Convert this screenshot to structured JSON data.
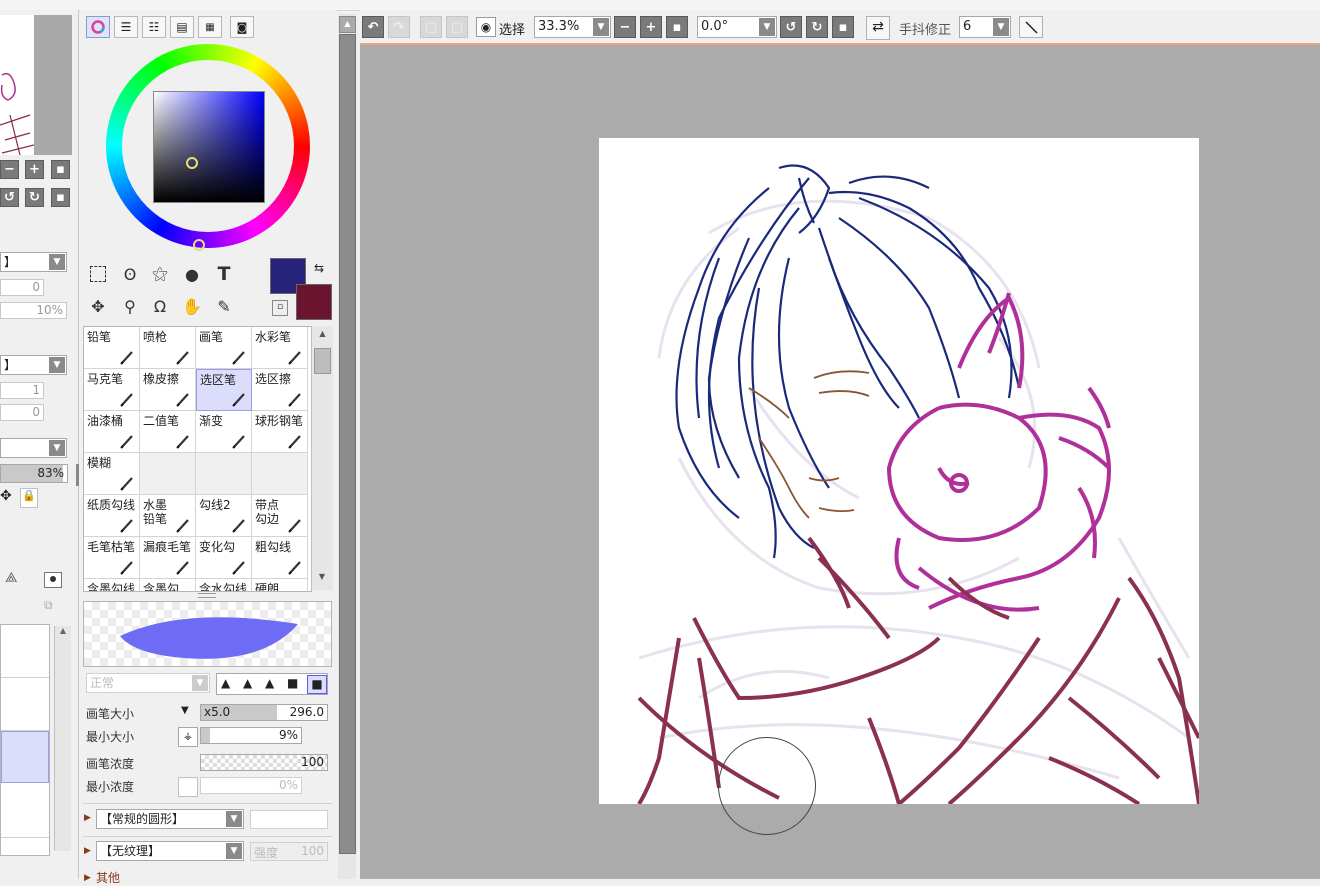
{
  "toolbar": {
    "view_label": "选择",
    "zoom_value": "33.3%",
    "rotation_value": "0.0°",
    "stabilizer_label": "手抖修正",
    "stabilizer_value": "6"
  },
  "left_panel": {
    "field_values": [
      "0",
      "10%",
      "1",
      "0"
    ],
    "combo_1": "】",
    "combo_2": "】",
    "opacity_value": "83%"
  },
  "colors": {
    "primary": "#27227a",
    "secondary": "#6a1430",
    "accent_selection": "#dcdcfb",
    "toolbar_border": "#f4a37a",
    "canvas_bg": "#ababab"
  },
  "brushes": [
    {
      "label": "铅笔",
      "icon": "pencil-icon"
    },
    {
      "label": "喷枪",
      "icon": "airbrush-icon"
    },
    {
      "label": "画笔",
      "icon": "brush-icon"
    },
    {
      "label": "水彩笔",
      "icon": "watercolor-icon"
    },
    {
      "label": "马克笔",
      "icon": "marker-icon"
    },
    {
      "label": "橡皮擦",
      "icon": "eraser-icon"
    },
    {
      "label": "选区笔",
      "icon": "selection-pen-icon",
      "selected": true
    },
    {
      "label": "选区擦",
      "icon": "selection-eraser-icon"
    },
    {
      "label": "油漆桶",
      "icon": "bucket-icon"
    },
    {
      "label": "二值笔",
      "icon": "binary-pen-icon"
    },
    {
      "label": "渐变",
      "icon": "gradient-icon"
    },
    {
      "label": "球形钢笔",
      "icon": "ballpen-icon"
    },
    {
      "label": "模糊",
      "icon": "blur-icon"
    },
    {
      "label": "",
      "icon": ""
    },
    {
      "label": "",
      "icon": ""
    },
    {
      "label": "",
      "icon": ""
    },
    {
      "label": "纸质勾线",
      "icon": "paper-line-icon"
    },
    {
      "label": "水墨\n铅笔",
      "icon": "ink-pencil-icon"
    },
    {
      "label": "勾线2",
      "icon": "line2-icon"
    },
    {
      "label": "带点\n勾边",
      "icon": "dot-line-icon"
    },
    {
      "label": "毛笔枯笔",
      "icon": "dry-brush-icon"
    },
    {
      "label": "漏痕毛笔",
      "icon": "leak-brush-icon"
    },
    {
      "label": "变化勾",
      "icon": "vary-line-icon"
    },
    {
      "label": "粗勾线",
      "icon": "thick-line-icon"
    },
    {
      "label": "含墨勾线",
      "icon": ""
    },
    {
      "label": "含墨勾",
      "icon": ""
    },
    {
      "label": "含水勾线",
      "icon": ""
    },
    {
      "label": "硬朗",
      "icon": ""
    }
  ],
  "brush_settings": {
    "blend_mode": "正常",
    "size_label": "画笔大小",
    "size_multiplier": "x5.0",
    "size_value": "296.0",
    "size_fraction": 0.6,
    "min_size_label": "最小大小",
    "min_size_value": "9%",
    "min_size_fraction": 0.09,
    "density_label": "画笔浓度",
    "density_value": "100",
    "min_density_label": "最小浓度",
    "min_density_value": "0%",
    "shape_label": "【常规的圆形】",
    "texture_label": "【无纹理】",
    "strength_label": "强度",
    "strength_value": "100",
    "more_label": "其他"
  }
}
